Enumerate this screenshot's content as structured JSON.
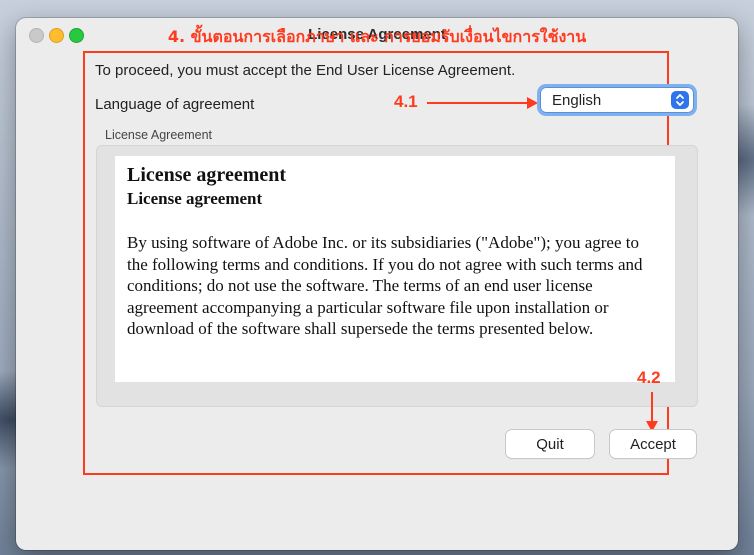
{
  "window": {
    "title": "License Agreement"
  },
  "annotations": {
    "heading": "4. ขั้นตอนการเลือกภาษา และ การยอมรับเงื่อนไขการใช้งาน",
    "step_select_language": "4.1",
    "step_accept": "4.2",
    "accent_color": "#ff3b1f"
  },
  "instructions": "To proceed, you must accept the End User License Agreement.",
  "language": {
    "label": "Language of agreement",
    "selected": "English"
  },
  "agreement": {
    "group_label": "License Agreement",
    "heading": "License agreement",
    "subheading": "License agreement",
    "body": "By using software of Adobe Inc. or its subsidiaries (\"Adobe\"); you agree to the following terms and conditions. If you do not agree with such terms and conditions; do not use the software. The terms of an end user license agreement accompanying a particular software file upon installation or download of the software shall supersede the terms presented below."
  },
  "buttons": {
    "quit": "Quit",
    "accept": "Accept"
  },
  "icons": {
    "close": "close-icon",
    "minimize": "minimize-icon",
    "maximize": "maximize-icon",
    "select": "chevron-up-down-icon"
  }
}
